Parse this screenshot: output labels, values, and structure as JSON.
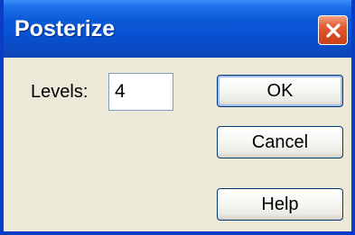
{
  "window": {
    "title": "Posterize",
    "close_icon": "close-icon",
    "accent": "#0a3cc8",
    "close_color": "#d64a22"
  },
  "form": {
    "levels_label": "Levels:",
    "levels_value": "4"
  },
  "buttons": {
    "ok_label": "OK",
    "cancel_label": "Cancel",
    "help_label": "Help"
  }
}
